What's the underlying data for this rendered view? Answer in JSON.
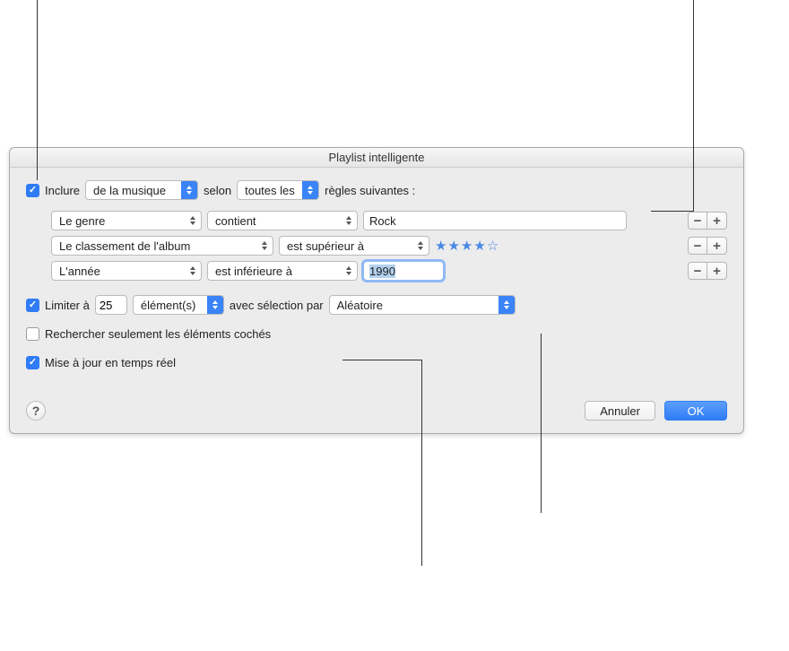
{
  "window": {
    "title": "Playlist intelligente"
  },
  "inclure": {
    "checked": true,
    "label": "Inclure",
    "media": "de la musique",
    "selon_label": "selon",
    "scope": "toutes les",
    "suffix": "règles suivantes :"
  },
  "rules": [
    {
      "attribute": "Le genre",
      "operator": "contient",
      "value": "Rock",
      "type": "text"
    },
    {
      "attribute": "Le classement de l'album",
      "operator": "est supérieur à",
      "value": 4,
      "type": "rating"
    },
    {
      "attribute": "L'année",
      "operator": "est inférieure à",
      "value": "1990",
      "type": "text",
      "focused": true,
      "selected": true
    }
  ],
  "limit": {
    "checked": true,
    "label": "Limiter à",
    "count": "25",
    "unit": "élément(s)",
    "selbylabel": "avec sélection par",
    "selection": "Aléatoire"
  },
  "only_checked": {
    "checked": false,
    "label": "Rechercher seulement les éléments cochés"
  },
  "live_update": {
    "checked": true,
    "label": "Mise à jour en temps réel"
  },
  "buttons": {
    "cancel": "Annuler",
    "ok": "OK",
    "minus": "−",
    "plus": "+",
    "help": "?"
  }
}
